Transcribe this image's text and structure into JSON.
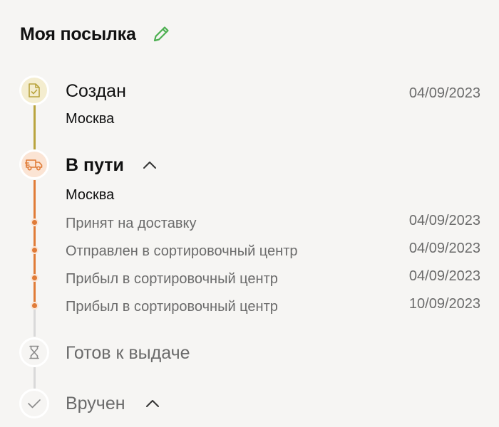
{
  "header": {
    "title": "Моя посылка"
  },
  "colors": {
    "background": "#f6f5f3",
    "created_accent": "#b9a43e",
    "created_bg": "#f4edcf",
    "transit_accent": "#e07b37",
    "transit_bg": "#fbe4d4",
    "pending_line": "#d9d9d9",
    "edit_icon": "#4caf50"
  },
  "stages": {
    "created": {
      "title": "Создан",
      "date": "04/09/2023",
      "city": "Москва",
      "icon": "document-check-icon"
    },
    "in_transit": {
      "title": "В пути",
      "city": "Москва",
      "icon": "truck-icon",
      "events": [
        {
          "text": "Принят на доставку",
          "date": "04/09/2023"
        },
        {
          "text": "Отправлен в сортировочный центр",
          "date": "04/09/2023"
        },
        {
          "text": "Прибыл в сортировочный центр",
          "date": "04/09/2023"
        },
        {
          "text": "Прибыл в сортировочный центр",
          "date": "10/09/2023"
        }
      ]
    },
    "ready": {
      "title": "Готов к выдаче",
      "icon": "hourglass-icon"
    },
    "delivered": {
      "title": "Вручен",
      "icon": "check-icon"
    }
  }
}
